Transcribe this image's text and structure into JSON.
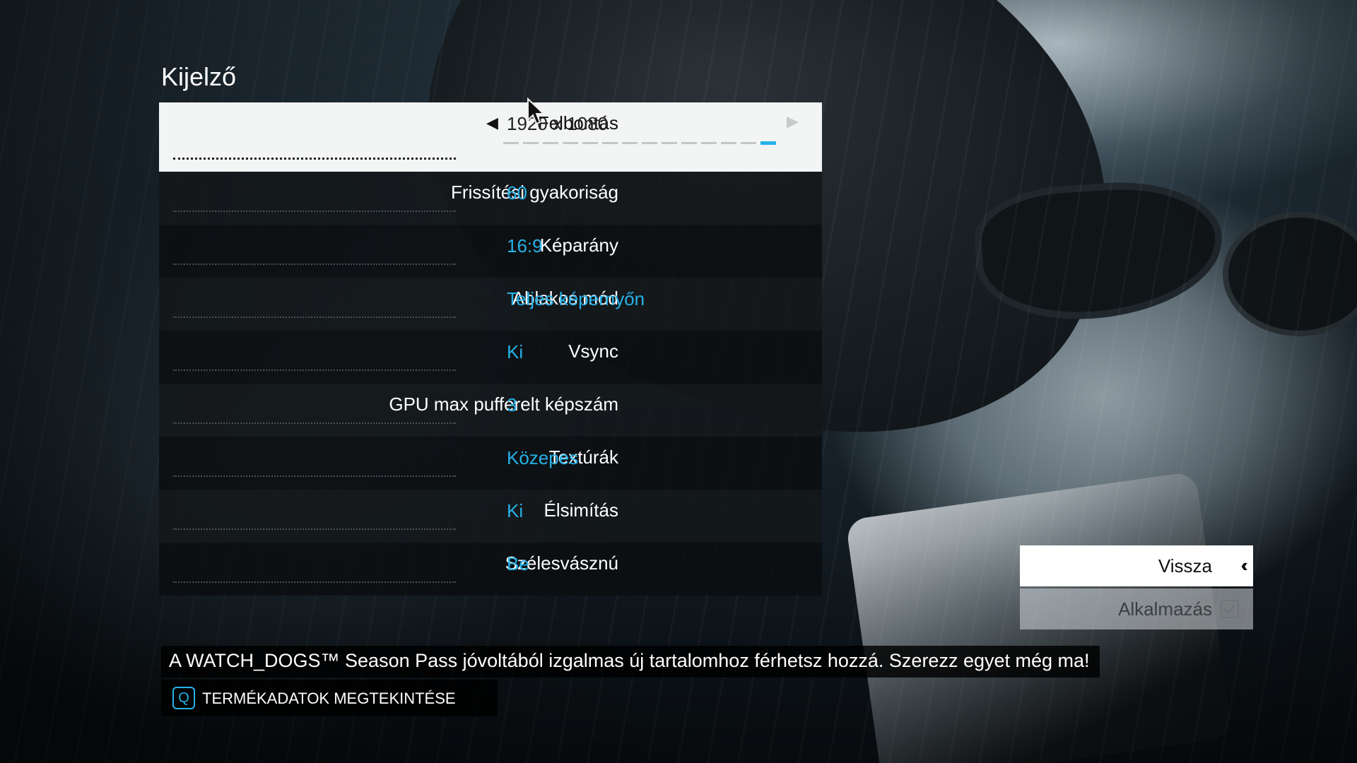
{
  "screen": {
    "title": "Kijelző"
  },
  "settings": [
    {
      "label": "Felbontás",
      "value": "1920 x 1080"
    },
    {
      "label": "Frissítési gyakoriság",
      "value": "60"
    },
    {
      "label": "Képarány",
      "value": "16:9"
    },
    {
      "label": "Ablakos mód",
      "value": "Teljes képernyőn"
    },
    {
      "label": "Vsync",
      "value": "Ki"
    },
    {
      "label": "GPU max pufferelt képszám",
      "value": "3"
    },
    {
      "label": "Textúrák",
      "value": "Közepes"
    },
    {
      "label": "Élsimítás",
      "value": "Ki"
    },
    {
      "label": "Szélesvásznú",
      "value": "Be"
    }
  ],
  "resolution_slider": {
    "steps": 14,
    "selected_index": 13
  },
  "buttons": {
    "back": "Vissza",
    "apply": "Alkalmazás"
  },
  "promo": {
    "text": "A WATCH_DOGS™ Season Pass jóvoltából izgalmas új tartalomhoz férhetsz hozzá. Szerezz egyet még ma!",
    "key": "Q",
    "action": "TERMÉKADATOK MEGTEKINTÉSE"
  },
  "colors": {
    "accent": "#27b2e8",
    "selected_row": "#f3f4f4"
  },
  "icons": {
    "back": "double-chevron-left-icon",
    "apply": "checkbox-check-icon",
    "prev": "triangle-left-icon",
    "next": "triangle-right-icon"
  }
}
